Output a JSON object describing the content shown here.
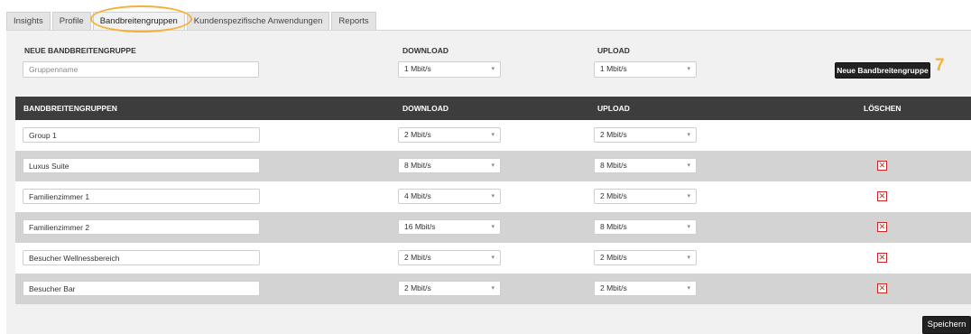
{
  "tabs": [
    {
      "label": "Insights"
    },
    {
      "label": "Profile"
    },
    {
      "label": "Bandbreitengruppen"
    },
    {
      "label": "Kundenspezifische Anwendungen"
    },
    {
      "label": "Reports"
    }
  ],
  "new_group": {
    "title": "NEUE BANDBREITENGRUPPE",
    "download_label": "DOWNLOAD",
    "upload_label": "UPLOAD",
    "name_placeholder": "Gruppenname",
    "download_value": "1 Mbit/s",
    "upload_value": "1 Mbit/s",
    "add_button": "Neue Bandbreitengruppe",
    "marker": "7"
  },
  "table": {
    "headers": {
      "group": "BANDBREITENGRUPPEN",
      "download": "DOWNLOAD",
      "upload": "UPLOAD",
      "delete": "LÖSCHEN"
    },
    "rows": [
      {
        "name": "Group 1",
        "download": "2 Mbit/s",
        "upload": "2 Mbit/s"
      },
      {
        "name": "Luxus Suite",
        "download": "8 Mbit/s",
        "upload": "8 Mbit/s"
      },
      {
        "name": "Familienzimmer 1",
        "download": "4 Mbit/s",
        "upload": "2 Mbit/s"
      },
      {
        "name": "Familienzimmer 2",
        "download": "16 Mbit/s",
        "upload": "8 Mbit/s"
      },
      {
        "name": "Besucher Wellnessbereich",
        "download": "2 Mbit/s",
        "upload": "2 Mbit/s"
      },
      {
        "name": "Besucher Bar",
        "download": "2 Mbit/s",
        "upload": "2 Mbit/s"
      }
    ]
  },
  "save_button": "Speichern",
  "colors": {
    "accent_highlight": "#f3b138",
    "header_bg": "#3d3d3d",
    "delete_red": "#c62828"
  }
}
